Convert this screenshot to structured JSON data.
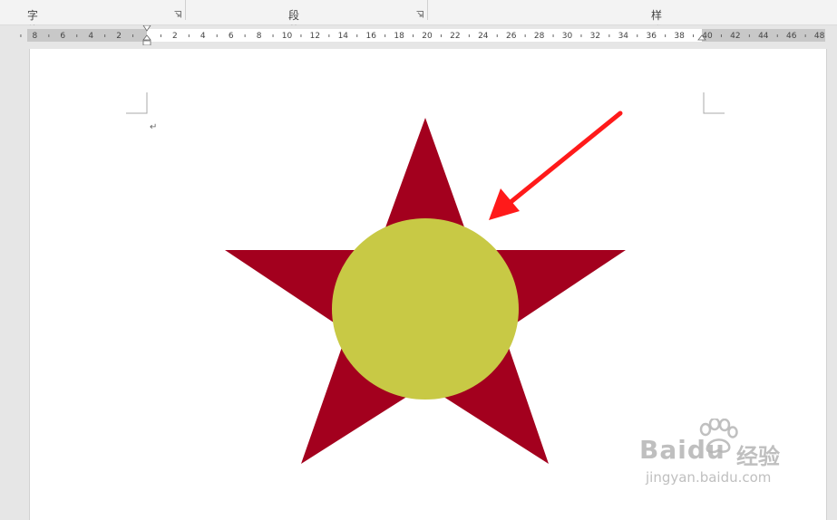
{
  "ribbon": {
    "font_group_label": "字体",
    "paragraph_group_label": "段落",
    "styles_group_label": "样式"
  },
  "ruler": {
    "left_ticks": [
      "8",
      "6",
      "4",
      "2"
    ],
    "right_ticks": [
      "2",
      "4",
      "6",
      "8",
      "10",
      "12",
      "14",
      "16",
      "18",
      "20",
      "22",
      "24",
      "26",
      "28",
      "30",
      "32",
      "34",
      "36",
      "38",
      "40",
      "42",
      "44",
      "46",
      "48"
    ]
  },
  "document": {
    "shapes": [
      {
        "name": "star",
        "color": "#a3001e"
      },
      {
        "name": "circle",
        "color": "#c8c945"
      },
      {
        "name": "arrow",
        "color": "#ff1a1a"
      }
    ]
  },
  "watermark": {
    "brand": "Baidu",
    "brand_cn": "经验",
    "url": "jingyan.baidu.com"
  }
}
